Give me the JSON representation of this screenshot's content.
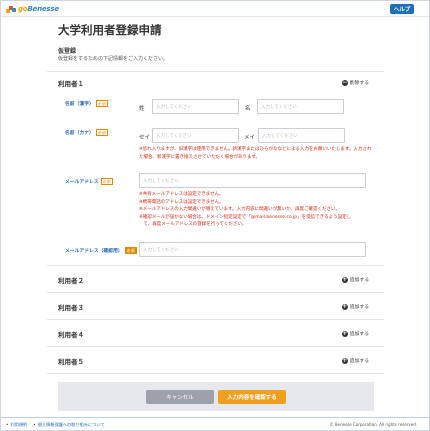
{
  "header": {
    "logo_prefix": "go",
    "logo_brand": "Benesse",
    "help_label": "ヘルプ"
  },
  "page_title": "大学利用者登録申請",
  "registration": {
    "heading": "仮登録",
    "instruction": "仮登録をするための下記情報をご入力ください。"
  },
  "user1": {
    "heading": "利用者１",
    "toggle_label": "削除する",
    "name_kanji_label": "名前（漢字）",
    "name_kana_label": "名前（カナ）",
    "email_label": "メールアドレス",
    "email_confirm_label": "メールアドレス（確認用）",
    "required_badge": "必須",
    "sei_kanji": "姓",
    "mei_kanji": "名",
    "sei_kana": "セイ",
    "mei_kana": "メイ",
    "placeholder": "入力してください",
    "kana_note_1": "※恐れ入りますが、旧漢字は使用できません。新漢字またはひらがななどによる入力をお願いいたします。入力され",
    "kana_note_2": "た場合、新漢字に置き換えさせていただく場合があります。",
    "email_notes": [
      "※共有メールアドレスは設定できません。",
      "※携帯電話のアドレスは設定できません。",
      "※メールアドレスの入力間違いが増えています。入力内容に間違いが無いか、再度ご確認ください。",
      "※確認メールが届かない場合は、ドメイン指定設定で「@mail.benesse.co.jp」を受信できるよう設定し",
      "　て、再度メールアドレスの登録を行ってください。"
    ]
  },
  "other_users": [
    {
      "heading": "利用者２",
      "toggle_label": "追加する"
    },
    {
      "heading": "利用者３",
      "toggle_label": "追加する"
    },
    {
      "heading": "利用者４",
      "toggle_label": "追加する"
    },
    {
      "heading": "利用者５",
      "toggle_label": "追加する"
    }
  ],
  "actions": {
    "cancel_label": "キャンセル",
    "confirm_label": "入力内容を確認する"
  },
  "footer": {
    "links": [
      "利用規約",
      "個人情報保護への取り組みについて"
    ],
    "copyright": "© Benesse Corporation. All rights reserved."
  },
  "colors": {
    "accent": "#1f66b0",
    "brand_orange": "#f0a020",
    "error": "#d9230f"
  }
}
